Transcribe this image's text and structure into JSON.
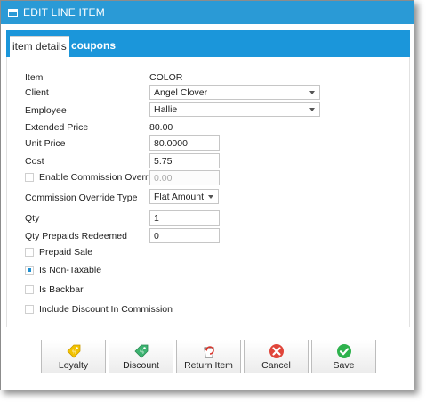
{
  "window": {
    "title": "EDIT LINE ITEM"
  },
  "tabs": [
    {
      "label": "item details",
      "active": true
    },
    {
      "label": "coupons",
      "active": false
    }
  ],
  "form": {
    "item": {
      "label": "Item",
      "value": "COLOR"
    },
    "client": {
      "label": "Client",
      "value": "Angel Clover"
    },
    "employee": {
      "label": "Employee",
      "value": "Hallie"
    },
    "extended_price": {
      "label": "Extended Price",
      "value": "80.00"
    },
    "unit_price": {
      "label": "Unit Price",
      "value": "80.0000"
    },
    "cost": {
      "label": "Cost",
      "value": "5.75"
    },
    "enable_commission_override": {
      "label": "Enable Commission Override",
      "checked": false,
      "value": "0.00"
    },
    "commission_override_type": {
      "label": "Commission Override Type",
      "value": "Flat Amount"
    },
    "qty": {
      "label": "Qty",
      "value": "1"
    },
    "qty_prepaids_redeemed": {
      "label": "Qty Prepaids Redeemed",
      "value": "0"
    },
    "prepaid_sale": {
      "label": "Prepaid Sale",
      "checked": false
    },
    "is_non_taxable": {
      "label": "Is Non-Taxable",
      "checked": true
    },
    "is_backbar": {
      "label": "Is Backbar",
      "checked": false
    },
    "include_discount_in_commission": {
      "label": "Include Discount In Commission",
      "checked": false
    }
  },
  "buttons": {
    "loyalty": {
      "label": "Loyalty",
      "icon": "loyalty-tag-icon"
    },
    "discount": {
      "label": "Discount",
      "icon": "discount-tag-icon"
    },
    "return_item": {
      "label": "Return Item",
      "icon": "return-icon"
    },
    "cancel": {
      "label": "Cancel",
      "icon": "cancel-x-icon"
    },
    "save": {
      "label": "Save",
      "icon": "save-check-icon"
    }
  },
  "colors": {
    "accent": "#2a9ad6",
    "cancel": "#e0453a",
    "save": "#2eb24d",
    "tag": "#f2c200",
    "discount": "#3cb371"
  }
}
